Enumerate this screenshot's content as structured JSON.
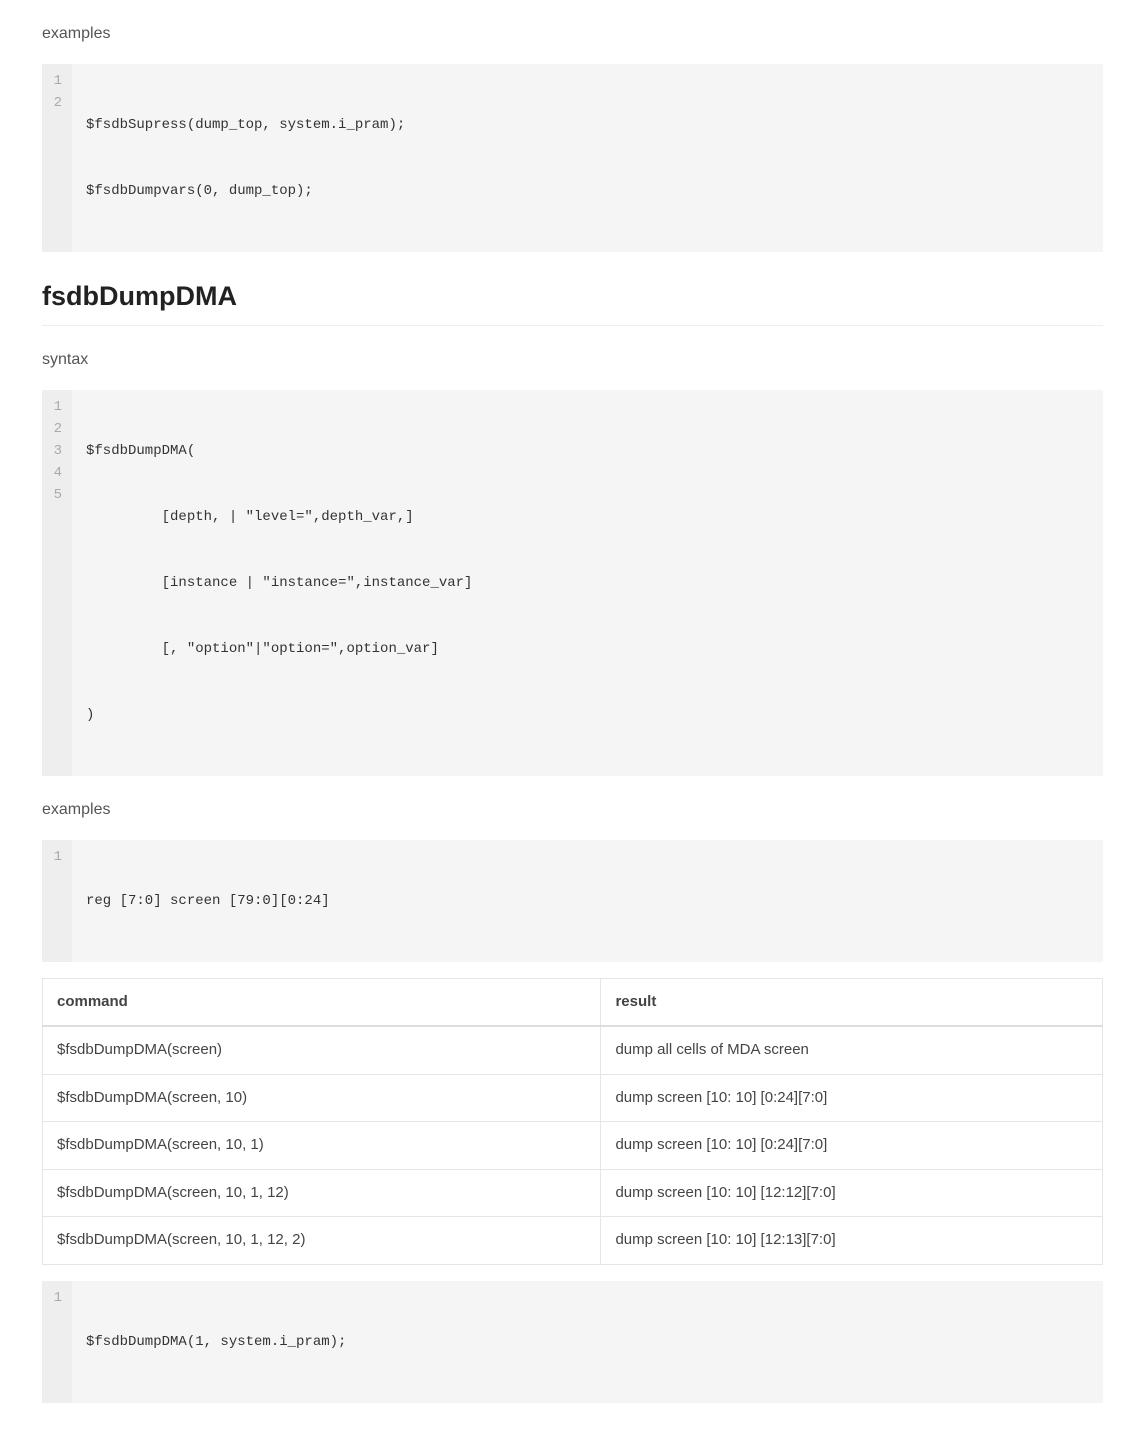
{
  "section1": {
    "examples_heading": "examples",
    "code1": {
      "lines": [
        "$fsdbSupress(dump_top, system.i_pram);",
        "$fsdbDumpvars(0, dump_top);"
      ]
    }
  },
  "section2": {
    "title": "fsdbDumpDMA",
    "syntax_heading": "syntax",
    "syntax_code": {
      "lines": [
        "$fsdbDumpDMA(",
        "         [depth, | \"level=\",depth_var,]",
        "         [instance | \"instance=\",instance_var]",
        "         [, \"option\"|\"option=\",option_var]",
        ")"
      ]
    },
    "examples_heading": "examples",
    "example_decl_code": {
      "lines": [
        "reg [7:0] screen [79:0][0:24]"
      ]
    },
    "table": {
      "headers": [
        "command",
        "result"
      ],
      "rows": [
        {
          "command": "$fsdbDumpDMA(screen)",
          "result": "dump all cells of MDA screen"
        },
        {
          "command": "$fsdbDumpDMA(screen, 10)",
          "result": "dump screen [10: 10] [0:24][7:0]"
        },
        {
          "command": "$fsdbDumpDMA(screen, 10, 1)",
          "result": "dump screen [10: 10] [0:24][7:0]"
        },
        {
          "command": "$fsdbDumpDMA(screen, 10, 1, 12)",
          "result": "dump screen [10: 10] [12:12][7:0]"
        },
        {
          "command": "$fsdbDumpDMA(screen, 10, 1, 12, 2)",
          "result": "dump screen [10: 10] [12:13][7:0]"
        }
      ]
    },
    "example_call_code": {
      "lines": [
        "$fsdbDumpDMA(1, system.i_pram);"
      ]
    }
  }
}
